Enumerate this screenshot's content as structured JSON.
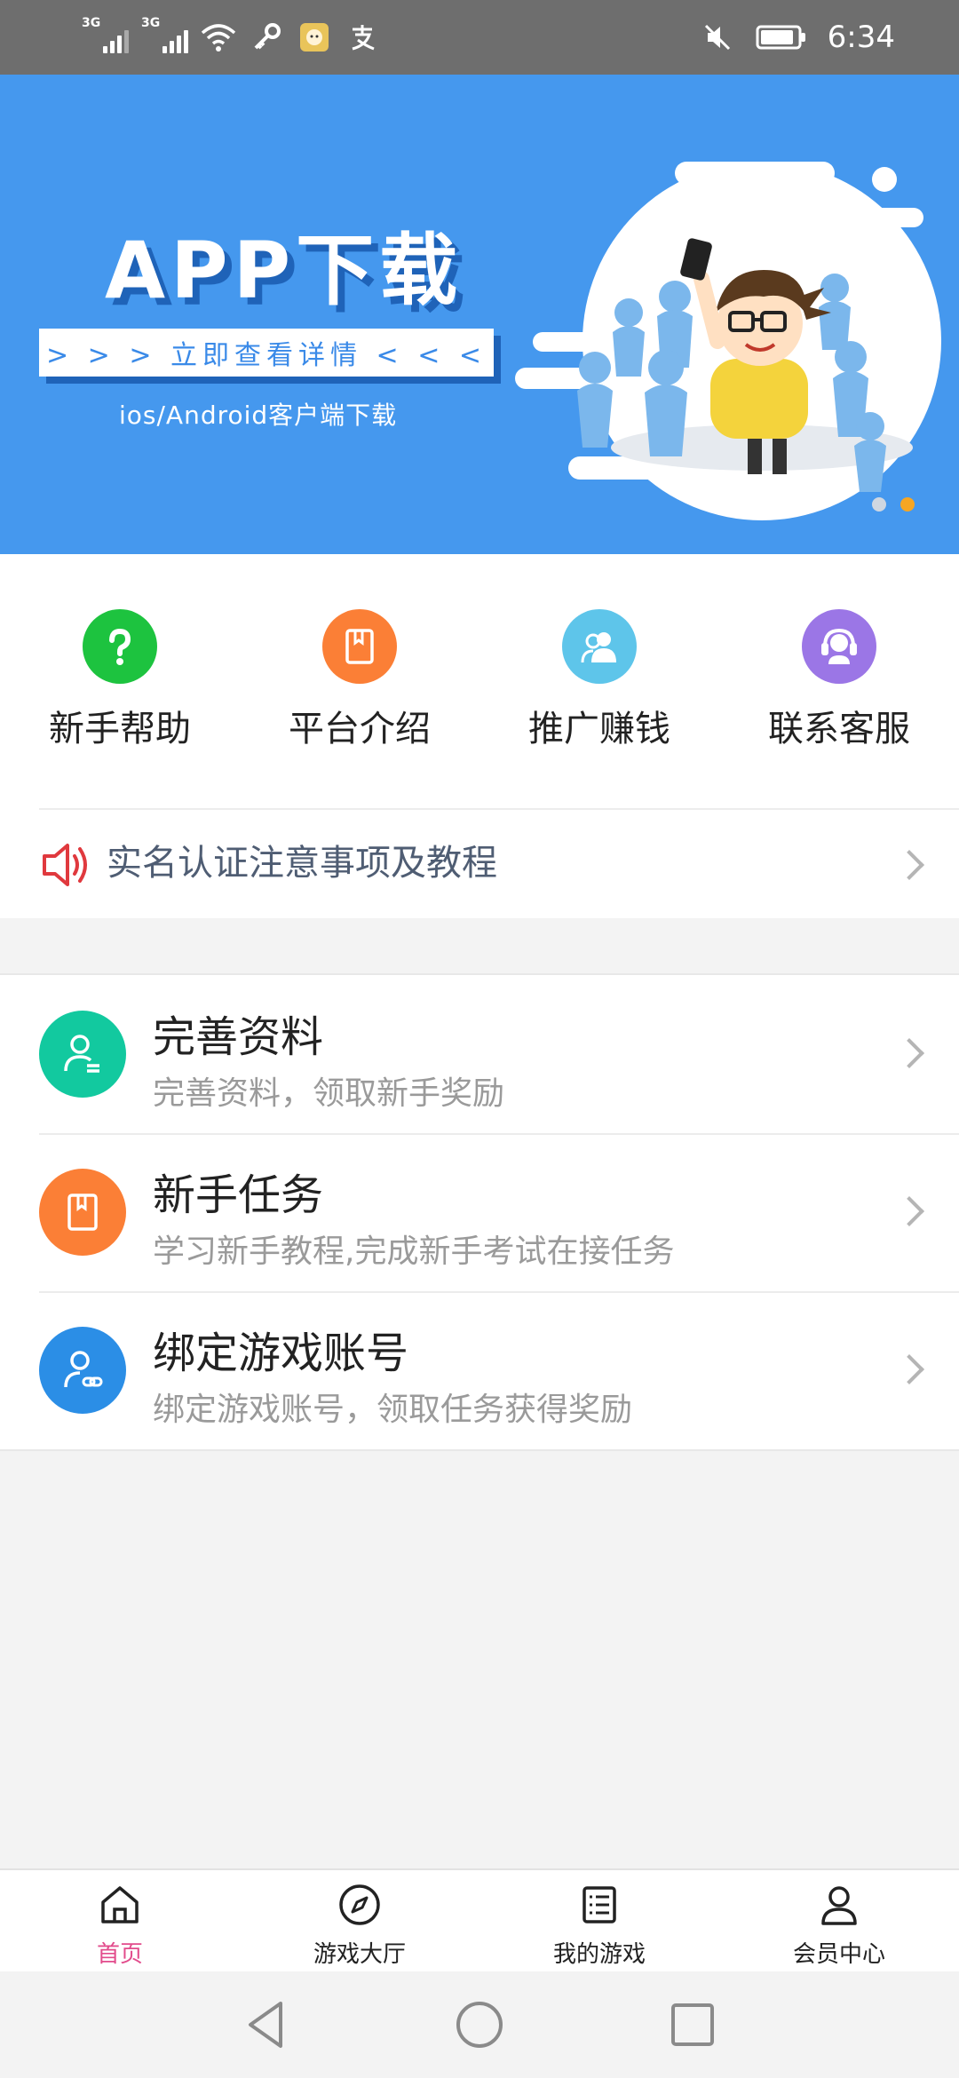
{
  "status_bar": {
    "signal_1_tag": "3G",
    "signal_2_tag": "3G",
    "time": "6:34",
    "icons": [
      "signal-icon",
      "signal-icon",
      "wifi-icon",
      "key-icon",
      "app-avatar-icon",
      "alipay-icon",
      "mute-icon",
      "battery-icon"
    ]
  },
  "banner": {
    "title": "APP下载",
    "button_text": "> > > 立即查看详情 < < <",
    "subtitle": "ios/Android客户端下载",
    "page_count": 2,
    "active_page": 2
  },
  "quick_menu": [
    {
      "label": "新手帮助",
      "icon": "question-icon",
      "color": "#1dc33f"
    },
    {
      "label": "平台介绍",
      "icon": "book-icon",
      "color": "#fb7f36"
    },
    {
      "label": "推广赚钱",
      "icon": "users-icon",
      "color": "#5ec5ea"
    },
    {
      "label": "联系客服",
      "icon": "headset-icon",
      "color": "#9b76e6"
    }
  ],
  "notice": {
    "text": "实名认证注意事项及教程",
    "icon": "speaker-icon"
  },
  "tasks": [
    {
      "title": "完善资料",
      "subtitle": "完善资料，领取新手奖励",
      "icon": "profile-icon",
      "color": "#12c99f"
    },
    {
      "title": "新手任务",
      "subtitle": "学习新手教程,完成新手考试在接任务",
      "icon": "book-icon",
      "color": "#fb7f36"
    },
    {
      "title": "绑定游戏账号",
      "subtitle": "绑定游戏账号，领取任务获得奖励",
      "icon": "user-link-icon",
      "color": "#2b8ee6"
    }
  ],
  "tabbar": [
    {
      "label": "首页",
      "icon": "home-icon",
      "active": true
    },
    {
      "label": "游戏大厅",
      "icon": "compass-icon",
      "active": false
    },
    {
      "label": "我的游戏",
      "icon": "list-icon",
      "active": false
    },
    {
      "label": "会员中心",
      "icon": "person-icon",
      "active": false
    }
  ],
  "colors": {
    "banner_bg": "#4598ee",
    "accent_active_tab": "#e24c8c",
    "dot_active": "#f6a623"
  }
}
